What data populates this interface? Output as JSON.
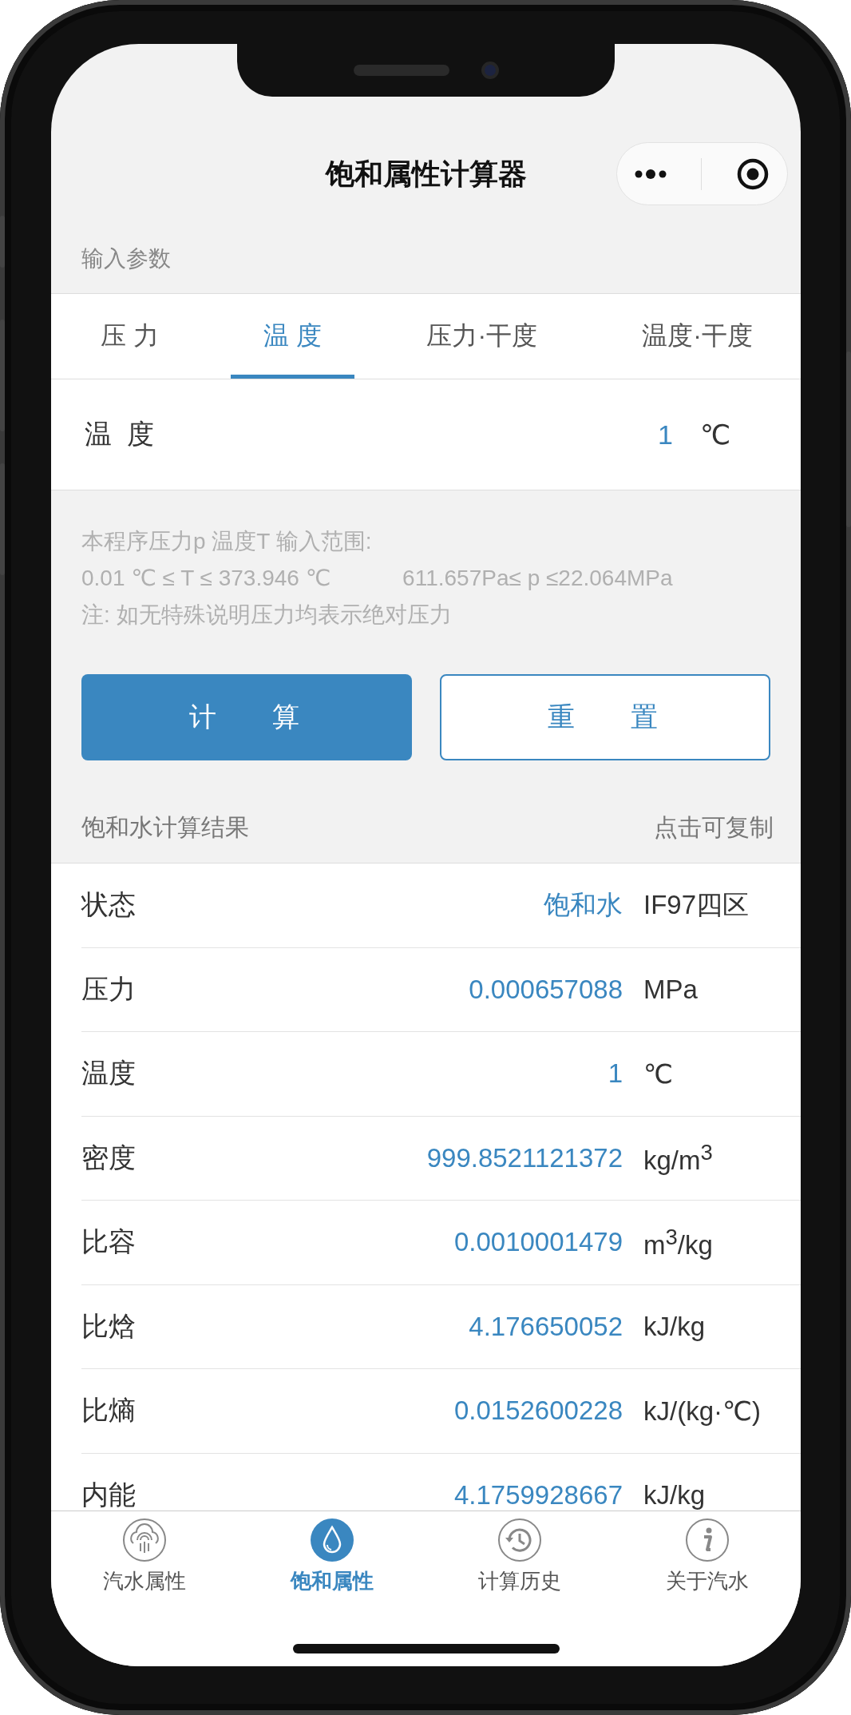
{
  "nav": {
    "title": "饱和属性计算器"
  },
  "section_label": "输入参数",
  "tabs": [
    {
      "label": "压 力",
      "selected": false
    },
    {
      "label": "温 度",
      "selected": true
    },
    {
      "label": "压力·干度",
      "selected": false
    },
    {
      "label": "温度·干度",
      "selected": false
    }
  ],
  "input": {
    "label": "温  度",
    "value": "1",
    "unit": "℃"
  },
  "notes": {
    "line_1": "本程序压力p 温度T 输入范围:",
    "range_T": "0.01 ℃ ≤ T ≤ 373.946 ℃",
    "range_p": "611.657Pa≤ p ≤22.064MPa",
    "line_3": "注: 如无特殊说明压力均表示绝对压力"
  },
  "buttons": [
    {
      "label": "计 算",
      "kind": "primary"
    },
    {
      "label": "重 置",
      "kind": "secondary"
    }
  ],
  "results": {
    "title": "饱和水计算结果",
    "hint": "点击可复制",
    "rows": [
      {
        "label": "状态",
        "value": "饱和水",
        "unit": "IF97四区"
      },
      {
        "label": "压力",
        "value": "0.000657088",
        "unit": "MPa"
      },
      {
        "label": "温度",
        "value": "1",
        "unit": "℃"
      },
      {
        "label": "密度",
        "value": "999.8521121372",
        "unit": "kg/m$^{3}$"
      },
      {
        "label": "比容",
        "value": "0.0010001479",
        "unit": "m$^{3}$/kg"
      },
      {
        "label": "比焓",
        "value": "4.176650052",
        "unit": "kJ/kg"
      },
      {
        "label": "比熵",
        "value": "0.0152600228",
        "unit": "kJ/(kg·℃)"
      },
      {
        "label": "内能",
        "value": "4.1759928667",
        "unit": "kJ/kg"
      }
    ]
  },
  "bottom_tabs": [
    {
      "label": "汽水属性",
      "kind": "steam",
      "selected": false
    },
    {
      "label": "饱和属性",
      "kind": "drop",
      "selected": true
    },
    {
      "label": "计算历史",
      "kind": "history",
      "selected": false
    },
    {
      "label": "关于汽水",
      "kind": "info",
      "selected": false
    }
  ]
}
